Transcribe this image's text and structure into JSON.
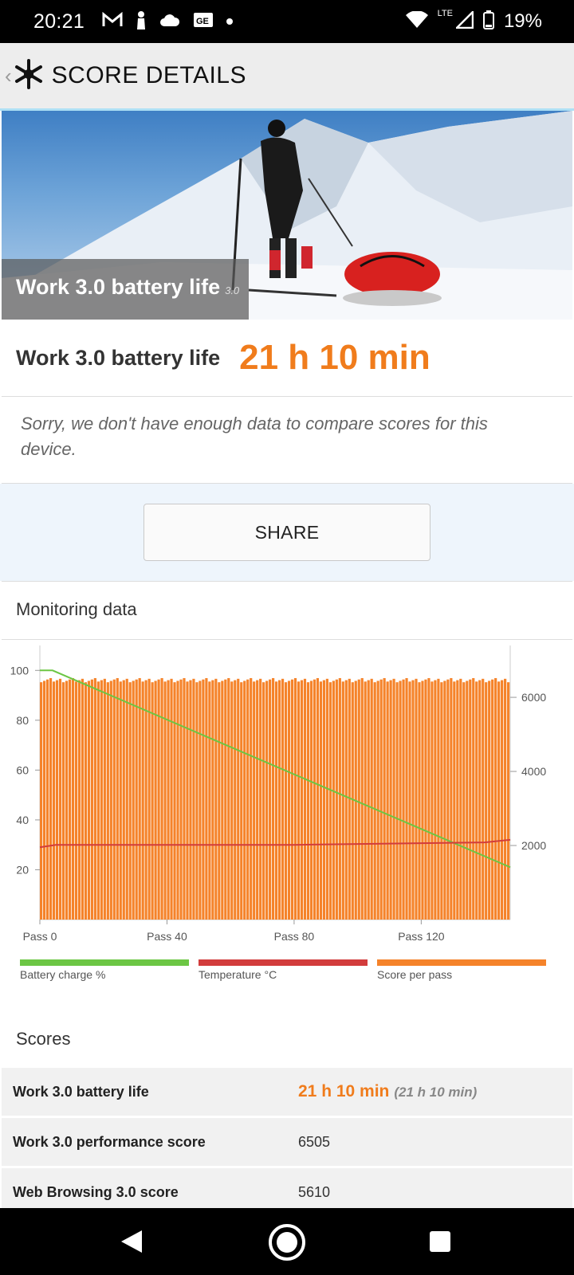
{
  "status_bar": {
    "time": "20:21",
    "network": "LTE",
    "battery": "19%",
    "icons": [
      "gmail-icon",
      "person-icon",
      "cloud-icon",
      "ge-icon",
      "dot-icon",
      "wifi-icon",
      "signal-icon",
      "battery-icon"
    ]
  },
  "header": {
    "title": "SCORE DETAILS",
    "icons": [
      "back-chevron-icon",
      "snowflake-icon"
    ]
  },
  "hero": {
    "label": "Work 3.0 battery life",
    "version": "3.0"
  },
  "result": {
    "label": "Work 3.0 battery life",
    "value": "21 h 10 min"
  },
  "notice": "Sorry, we don't have enough data to compare scores for this device.",
  "share_label": "SHARE",
  "monitoring": {
    "title": "Monitoring data"
  },
  "chart_data": {
    "type": "bar",
    "x_axis": {
      "ticks": [
        "Pass 0",
        "Pass 40",
        "Pass 80",
        "Pass 120"
      ],
      "range": [
        0,
        148
      ]
    },
    "left_axis": {
      "ticks": [
        "100",
        "80",
        "60",
        "40",
        "20"
      ],
      "range": [
        0,
        110
      ]
    },
    "right_axis": {
      "ticks": [
        "6000",
        "4000",
        "2000"
      ],
      "range": [
        0,
        7400
      ]
    },
    "series": [
      {
        "name": "Battery charge %",
        "type": "line",
        "color": "#6cc644",
        "axis": "left",
        "x": [
          0,
          4,
          148
        ],
        "values": [
          100,
          100,
          21
        ]
      },
      {
        "name": "Temperature °C",
        "type": "line",
        "color": "#d23c3c",
        "axis": "left",
        "x": [
          0,
          5,
          40,
          80,
          140,
          148
        ],
        "values": [
          29,
          30,
          30,
          30,
          31,
          32
        ]
      },
      {
        "name": "Score per pass",
        "type": "bar",
        "color": "#f5832a",
        "axis": "right",
        "count": 148,
        "approx_value": 6505
      }
    ],
    "legend": [
      "Battery charge %",
      "Temperature °C",
      "Score per pass"
    ],
    "legend_position": "bottom"
  },
  "scores": {
    "title": "Scores",
    "rows": [
      {
        "name": "Work 3.0 battery life",
        "value": "21 h 10 min",
        "sub": "(21 h 10 min)"
      },
      {
        "name": "Work 3.0 performance score",
        "value": "6505"
      },
      {
        "name": "Web Browsing 3.0 score",
        "value": "5610"
      }
    ]
  },
  "navbar": {
    "icons": [
      "back-icon",
      "home-icon",
      "recents-icon"
    ]
  }
}
